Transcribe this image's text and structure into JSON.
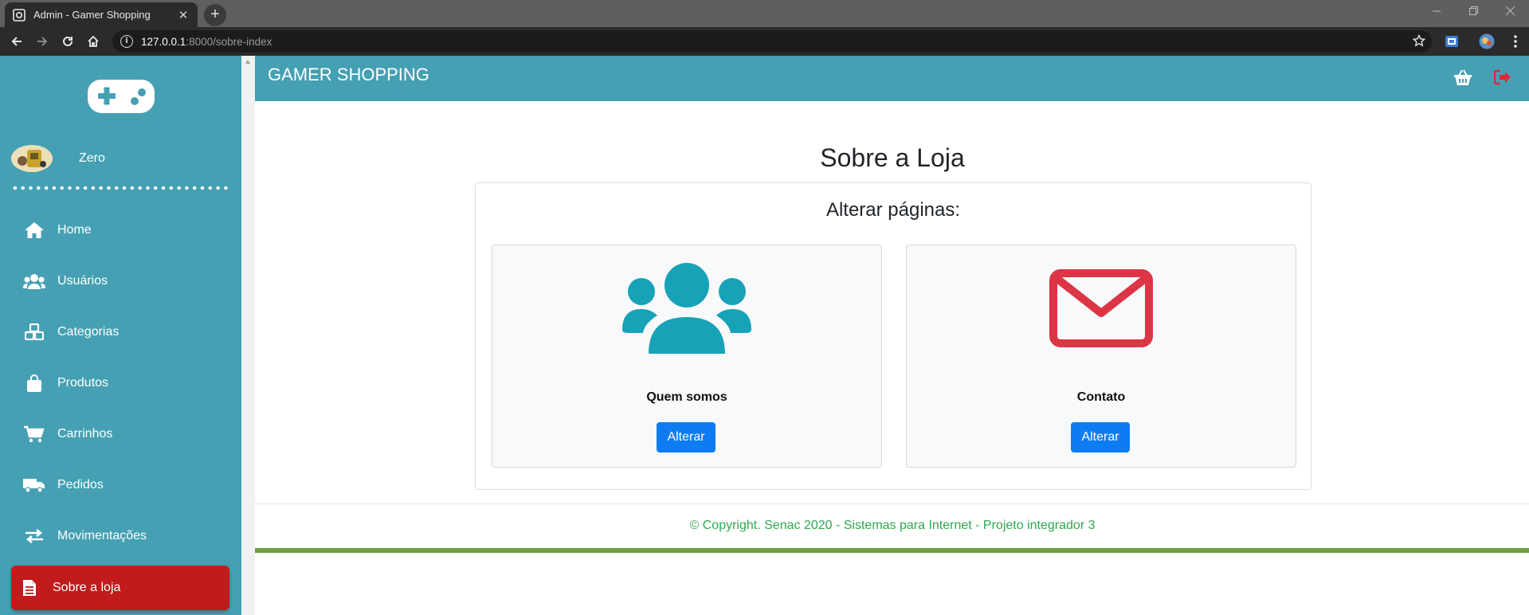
{
  "browser": {
    "tab_title": "Admin - Gamer Shopping",
    "tab_close": "✕",
    "new_tab": "+",
    "url_host": "127.0.0.1",
    "url_path": ":8000/sobre-index",
    "info_glyph": "i"
  },
  "sidebar": {
    "username": "Zero",
    "items": [
      {
        "label": "Home",
        "icon": "home-icon"
      },
      {
        "label": "Usuários",
        "icon": "users-icon"
      },
      {
        "label": "Categorias",
        "icon": "cubes-icon"
      },
      {
        "label": "Produtos",
        "icon": "shopping-bag-icon"
      },
      {
        "label": "Carrinhos",
        "icon": "cart-icon"
      },
      {
        "label": "Pedidos",
        "icon": "truck-icon"
      },
      {
        "label": "Movimentações",
        "icon": "exchange-icon"
      },
      {
        "label": "Sobre a loja",
        "icon": "file-icon",
        "active": true
      }
    ]
  },
  "topnav": {
    "brand": "GAMER SHOPPING"
  },
  "main": {
    "title": "Sobre a Loja",
    "subtitle": "Alterar páginas:",
    "cards": [
      {
        "label": "Quem somos",
        "button": "Alterar",
        "icon": "users-icon"
      },
      {
        "label": "Contato",
        "button": "Alterar",
        "icon": "envelope-icon"
      }
    ]
  },
  "footer": {
    "copyright": "© Copyright. Senac 2020 - Sistemas para Internet - Projeto integrador 3"
  },
  "colors": {
    "accent": "#45a0b3",
    "active_menu": "#c11b1b",
    "button": "#0d7cf2",
    "users_icon": "#17a2b8",
    "envelope_icon": "#dc3545",
    "footer_text": "#2fa84f"
  }
}
